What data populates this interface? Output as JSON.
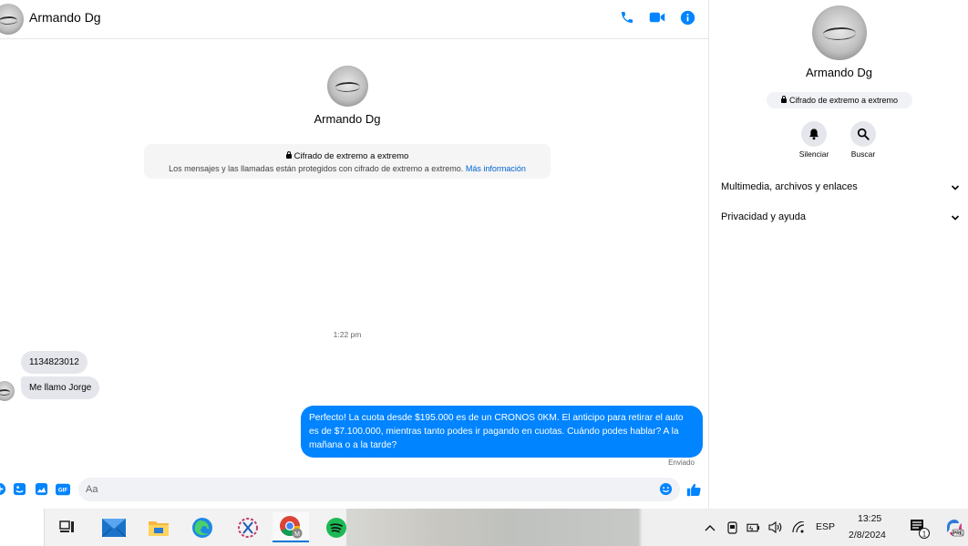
{
  "colors": {
    "accent": "#0084ff",
    "link": "#0064d1",
    "bubble_in": "#e4e6eb"
  },
  "header": {
    "name": "Armando Dg",
    "icons": [
      "phone-icon",
      "video-camera-icon",
      "info-icon"
    ]
  },
  "intro": {
    "name": "Armando Dg",
    "e2e_title": "Cifrado de extremo a extremo",
    "e2e_text": "Los mensajes y las llamadas están protegidos con cifrado de extremo a extremo.",
    "e2e_link": "Más información"
  },
  "conversation": {
    "timestamp": "1:22 pm",
    "incoming": [
      {
        "text": "1134823012"
      },
      {
        "text": "Me llamo Jorge"
      }
    ],
    "outgoing": {
      "text": "Perfecto! La cuota desde $195.000 es de un CRONOS 0KM. El anticipo para retirar el auto es de $7.100.000, mientras tanto podes ir pagando en cuotas. Cuándo podes hablar? A la mañana o a la tarde?",
      "status": "Enviado"
    }
  },
  "composer": {
    "placeholder": "Aa",
    "icons": [
      "plus-circle-icon",
      "sticker-icon",
      "gallery-icon",
      "gif-icon",
      "emoji-icon",
      "like-icon"
    ],
    "gif_label": "GIF"
  },
  "info_panel": {
    "name": "Armando Dg",
    "e2e_pill": "Cifrado de extremo a extremo",
    "actions": [
      {
        "label": "Silenciar",
        "icon": "bell-icon"
      },
      {
        "label": "Buscar",
        "icon": "search-icon"
      }
    ],
    "sections": [
      {
        "label": "Multimedia, archivos y enlaces"
      },
      {
        "label": "Privacidad y ayuda"
      }
    ]
  },
  "taskbar": {
    "apps": [
      "task-view-icon",
      "mail-icon",
      "file-explorer-icon",
      "edge-icon",
      "snipping-tool-icon",
      "chrome-icon",
      "spotify-icon"
    ],
    "language": "ESP",
    "time": "13:25",
    "date": "2/8/2024",
    "notification_count": "1",
    "chrome_profile_letter": "M",
    "copilot_badge": "PRE"
  }
}
